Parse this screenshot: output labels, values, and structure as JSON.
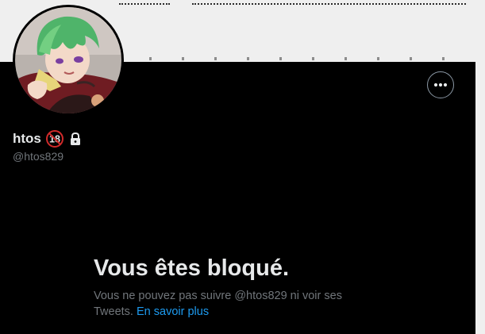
{
  "profile": {
    "display_name": "htos",
    "age_badge": "18",
    "handle": "@htos829",
    "avatar_icon": "anime-character-avatar"
  },
  "header": {
    "more_icon": "more-horizontal-icon"
  },
  "blocked": {
    "title": "Vous êtes bloqué.",
    "message": "Vous ne pouvez pas suivre @htos829 ni voir ses Tweets.",
    "learn_more": "En savoir plus"
  },
  "colors": {
    "background": "#000000",
    "primary_text": "#e7e9ea",
    "secondary_text": "#71767b",
    "link": "#1d9bf0",
    "banner": "#efefef"
  }
}
